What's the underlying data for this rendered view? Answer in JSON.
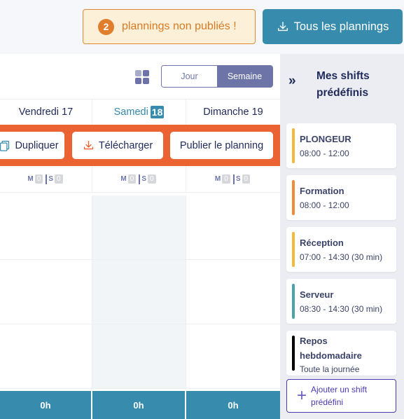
{
  "topbar": {
    "unpublished": {
      "count": "2",
      "label": "plannings non publiés !"
    },
    "all_plannings_label": "Tous les plannings"
  },
  "view": {
    "grid_icon": "grid-icon",
    "toggle": [
      {
        "label": "Jour",
        "active": false
      },
      {
        "label": "Semaine",
        "active": true
      }
    ]
  },
  "days": [
    {
      "name": "Vendredi",
      "num": "17",
      "today": false
    },
    {
      "name": "Samedi",
      "num": "18",
      "today": true
    },
    {
      "name": "Dimanche",
      "num": "19",
      "today": false
    }
  ],
  "actions": {
    "duplicate": "Dupliquer",
    "download": "Télécharger",
    "publish": "Publier le planning"
  },
  "counts": [
    {
      "m_label": "M",
      "m": "0",
      "s_label": "S",
      "s": "0"
    },
    {
      "m_label": "M",
      "m": "0",
      "s_label": "S",
      "s": "0"
    },
    {
      "m_label": "M",
      "m": "0",
      "s_label": "S",
      "s": "0"
    }
  ],
  "totals": [
    "0h",
    "0h",
    "0h"
  ],
  "sidebar": {
    "title": "Mes shifts prédéfinis",
    "collapse_icon": "»",
    "shifts": [
      {
        "name": "PLONGEUR",
        "time": "08:00 - 12:00",
        "color": "#f2b93b"
      },
      {
        "name": "Formation",
        "time": "08:00 - 12:00",
        "color": "#ef8c3a"
      },
      {
        "name": "Réception",
        "time": "07:00 - 14:30 (30 min)",
        "color": "#f2b93b"
      },
      {
        "name": "Serveur",
        "time": "08:30 - 14:30 (30 min)",
        "color": "#4ca3ad"
      },
      {
        "name": "Repos hebdomadaire",
        "time": "Toute la journée",
        "color": "#000000"
      }
    ],
    "add_label": "Ajouter un shift prédéfini"
  },
  "colors": {
    "accent_blue": "#378cad",
    "action_orange": "#ec6333",
    "warning_bg": "#fdf0d8",
    "toggle_purple": "#6d75a8"
  }
}
